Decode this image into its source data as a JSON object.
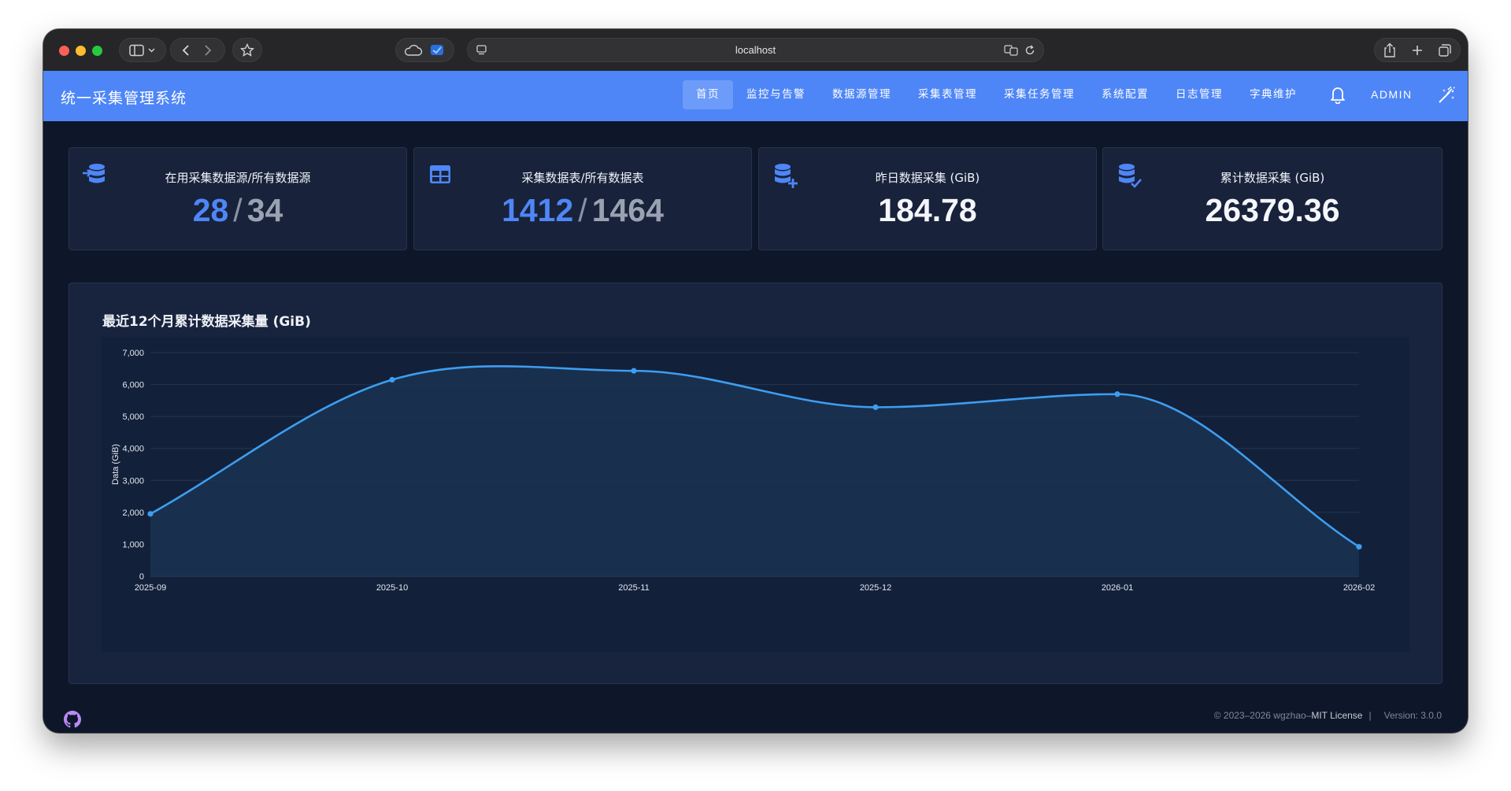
{
  "browser": {
    "url": "localhost"
  },
  "app": {
    "title": "统一采集管理系统",
    "nav": [
      {
        "label": "首页",
        "active": true
      },
      {
        "label": "监控与告警",
        "active": false
      },
      {
        "label": "数据源管理",
        "active": false
      },
      {
        "label": "采集表管理",
        "active": false
      },
      {
        "label": "采集任务管理",
        "active": false
      },
      {
        "label": "系统配置",
        "active": false
      },
      {
        "label": "日志管理",
        "active": false
      },
      {
        "label": "字典维护",
        "active": false
      }
    ],
    "user": "ADMIN",
    "icons": {
      "notifications": "bell-icon",
      "theme": "theme-toggle-icon"
    }
  },
  "stats": [
    {
      "title": "在用采集数据源/所有数据源",
      "value": "28",
      "total": "34",
      "icon": "database-import-icon"
    },
    {
      "title": "采集数据表/所有数据表",
      "value": "1412",
      "total": "1464",
      "icon": "table-icon"
    },
    {
      "title": "昨日数据采集 (GiB)",
      "value": "184.78",
      "icon": "database-plus-icon"
    },
    {
      "title": "累计数据采集 (GiB)",
      "value": "26379.36",
      "icon": "database-check-icon"
    }
  ],
  "chart": {
    "title": "最近12个月累计数据采集量 (GiB)"
  },
  "chart_data": {
    "type": "area",
    "x": [
      "2025-09",
      "2025-10",
      "2025-11",
      "2025-12",
      "2026-01",
      "2026-02"
    ],
    "series": [
      {
        "values": [
          1950,
          6150,
          6430,
          5290,
          5700,
          920
        ]
      }
    ],
    "ylabel": "Data (GiB)",
    "xlabel": "",
    "ylim": [
      0,
      7000
    ],
    "yticks": [
      "0",
      "1,000",
      "2,000",
      "3,000",
      "4,000",
      "5,000",
      "6,000",
      "7,000"
    ],
    "grid": true,
    "line_color": "#3e9df0",
    "fill_color": "#1a3251"
  },
  "footer": {
    "copyright": "© 2023–2026 wgzhao–",
    "license": "MIT License",
    "separator": "|",
    "version": "Version: 3.0.0",
    "icon": "github-icon"
  },
  "colors": {
    "header": "#4e86f7",
    "accent": "#4f86f7",
    "background": "#0e1729",
    "card": "#18223a"
  }
}
